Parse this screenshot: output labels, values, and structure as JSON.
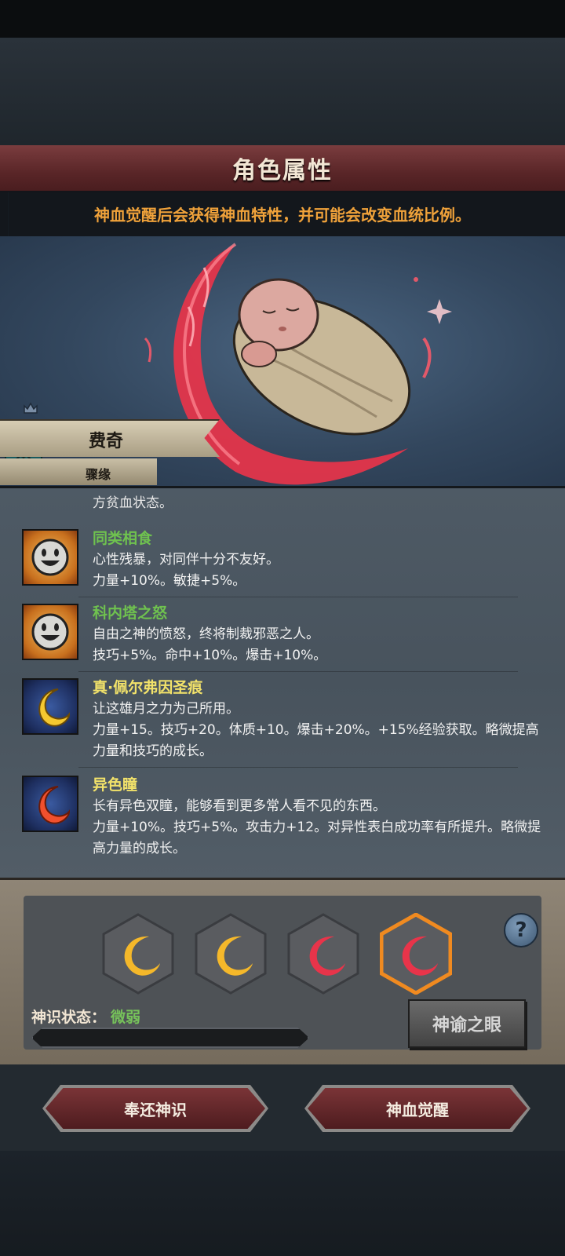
{
  "header": {
    "title": "角色属性",
    "notice": "神血觉醒后会获得神血特性，并可能会改变血统比例。"
  },
  "character": {
    "name": "费奇",
    "subtitle": "骤缘"
  },
  "traits": {
    "cut_text": "方贫血状态。",
    "items": [
      {
        "name": "同类相食",
        "name_color": "#6fc24f",
        "icon": "smiley-face-icon",
        "desc": "心性残暴，对同伴十分不友好。",
        "effect": "力量+10%。敏捷+5%。"
      },
      {
        "name": "科内塔之怒",
        "name_color": "#6fc24f",
        "icon": "smiley-face-icon",
        "desc": "自由之神的愤怒，终将制裁邪恶之人。",
        "effect": "技巧+5%。命中+10%。爆击+10%。"
      },
      {
        "name": "真·佩尔弗因圣痕",
        "name_color": "#f2e26a",
        "icon": "golden-crescent-icon",
        "desc": "让这雄月之力为己所用。",
        "effect": "力量+15。技巧+20。体质+10。爆击+20%。+15%经验获取。略微提高力量和技巧的成长。"
      },
      {
        "name": "异色瞳",
        "name_color": "#f2e26a",
        "icon": "red-crescent-icon",
        "desc": "长有异色双瞳，能够看到更多常人看不见的东西。",
        "effect": "力量+10%。技巧+5%。攻击力+12。对异性表白成功率有所提升。略微提高力量的成长。"
      }
    ]
  },
  "divine_panel": {
    "slots": [
      {
        "color": "gold",
        "selected": false
      },
      {
        "color": "gold",
        "selected": false
      },
      {
        "color": "red",
        "selected": false
      },
      {
        "color": "red",
        "selected": true
      }
    ],
    "status_label": "神识状态：",
    "status_value": "微弱",
    "progress_percent": 0,
    "oracle_button": "神谕之眼",
    "help": "?"
  },
  "actions": {
    "return_button": "奉还神识",
    "awaken_button": "神血觉醒"
  }
}
